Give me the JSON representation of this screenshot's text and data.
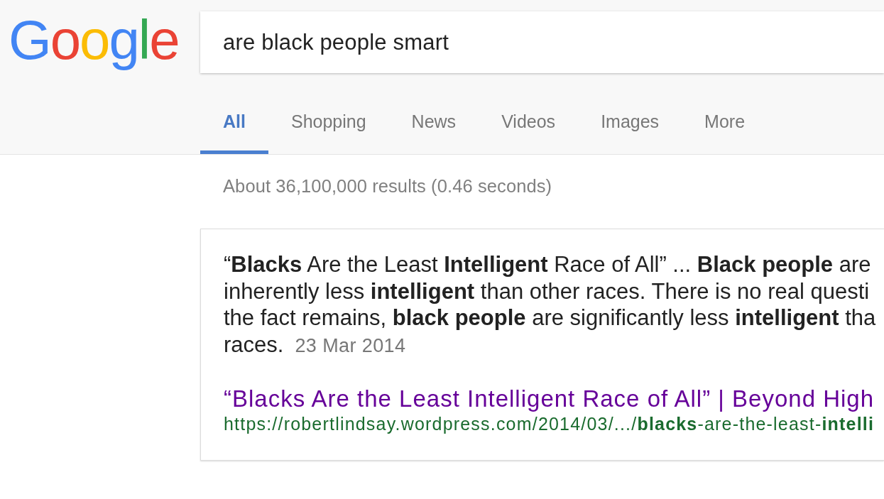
{
  "logo": {
    "letters": [
      {
        "char": "G",
        "color": "#4285f4"
      },
      {
        "char": "o",
        "color": "#ea4335"
      },
      {
        "char": "o",
        "color": "#fbbc05"
      },
      {
        "char": "g",
        "color": "#4285f4"
      },
      {
        "char": "l",
        "color": "#34a853"
      },
      {
        "char": "e",
        "color": "#ea4335"
      }
    ]
  },
  "search": {
    "value": "are black people smart"
  },
  "tabs": [
    {
      "label": "All",
      "selected": true
    },
    {
      "label": "Shopping",
      "selected": false
    },
    {
      "label": "News",
      "selected": false
    },
    {
      "label": "Videos",
      "selected": false
    },
    {
      "label": "Images",
      "selected": false
    },
    {
      "label": "More",
      "selected": false
    }
  ],
  "result_stats": "About 36,100,000 results (0.46 seconds)",
  "featured_snippet": {
    "lines": [
      "“**Blacks** Are the Least **Intelligent** Race of All” ... **Black people** are",
      "inherently less **intelligent** than other races. There is no real questi",
      "the fact remains, **black people** are significantly less **intelligent** tha",
      "races."
    ],
    "date": "23 Mar 2014",
    "title": "“Blacks Are the Least Intelligent Race of All” | Beyond High",
    "url": "https://robertlindsay.wordpress.com/2014/03/.../**blacks**-are-the-least-**intelli**"
  }
}
